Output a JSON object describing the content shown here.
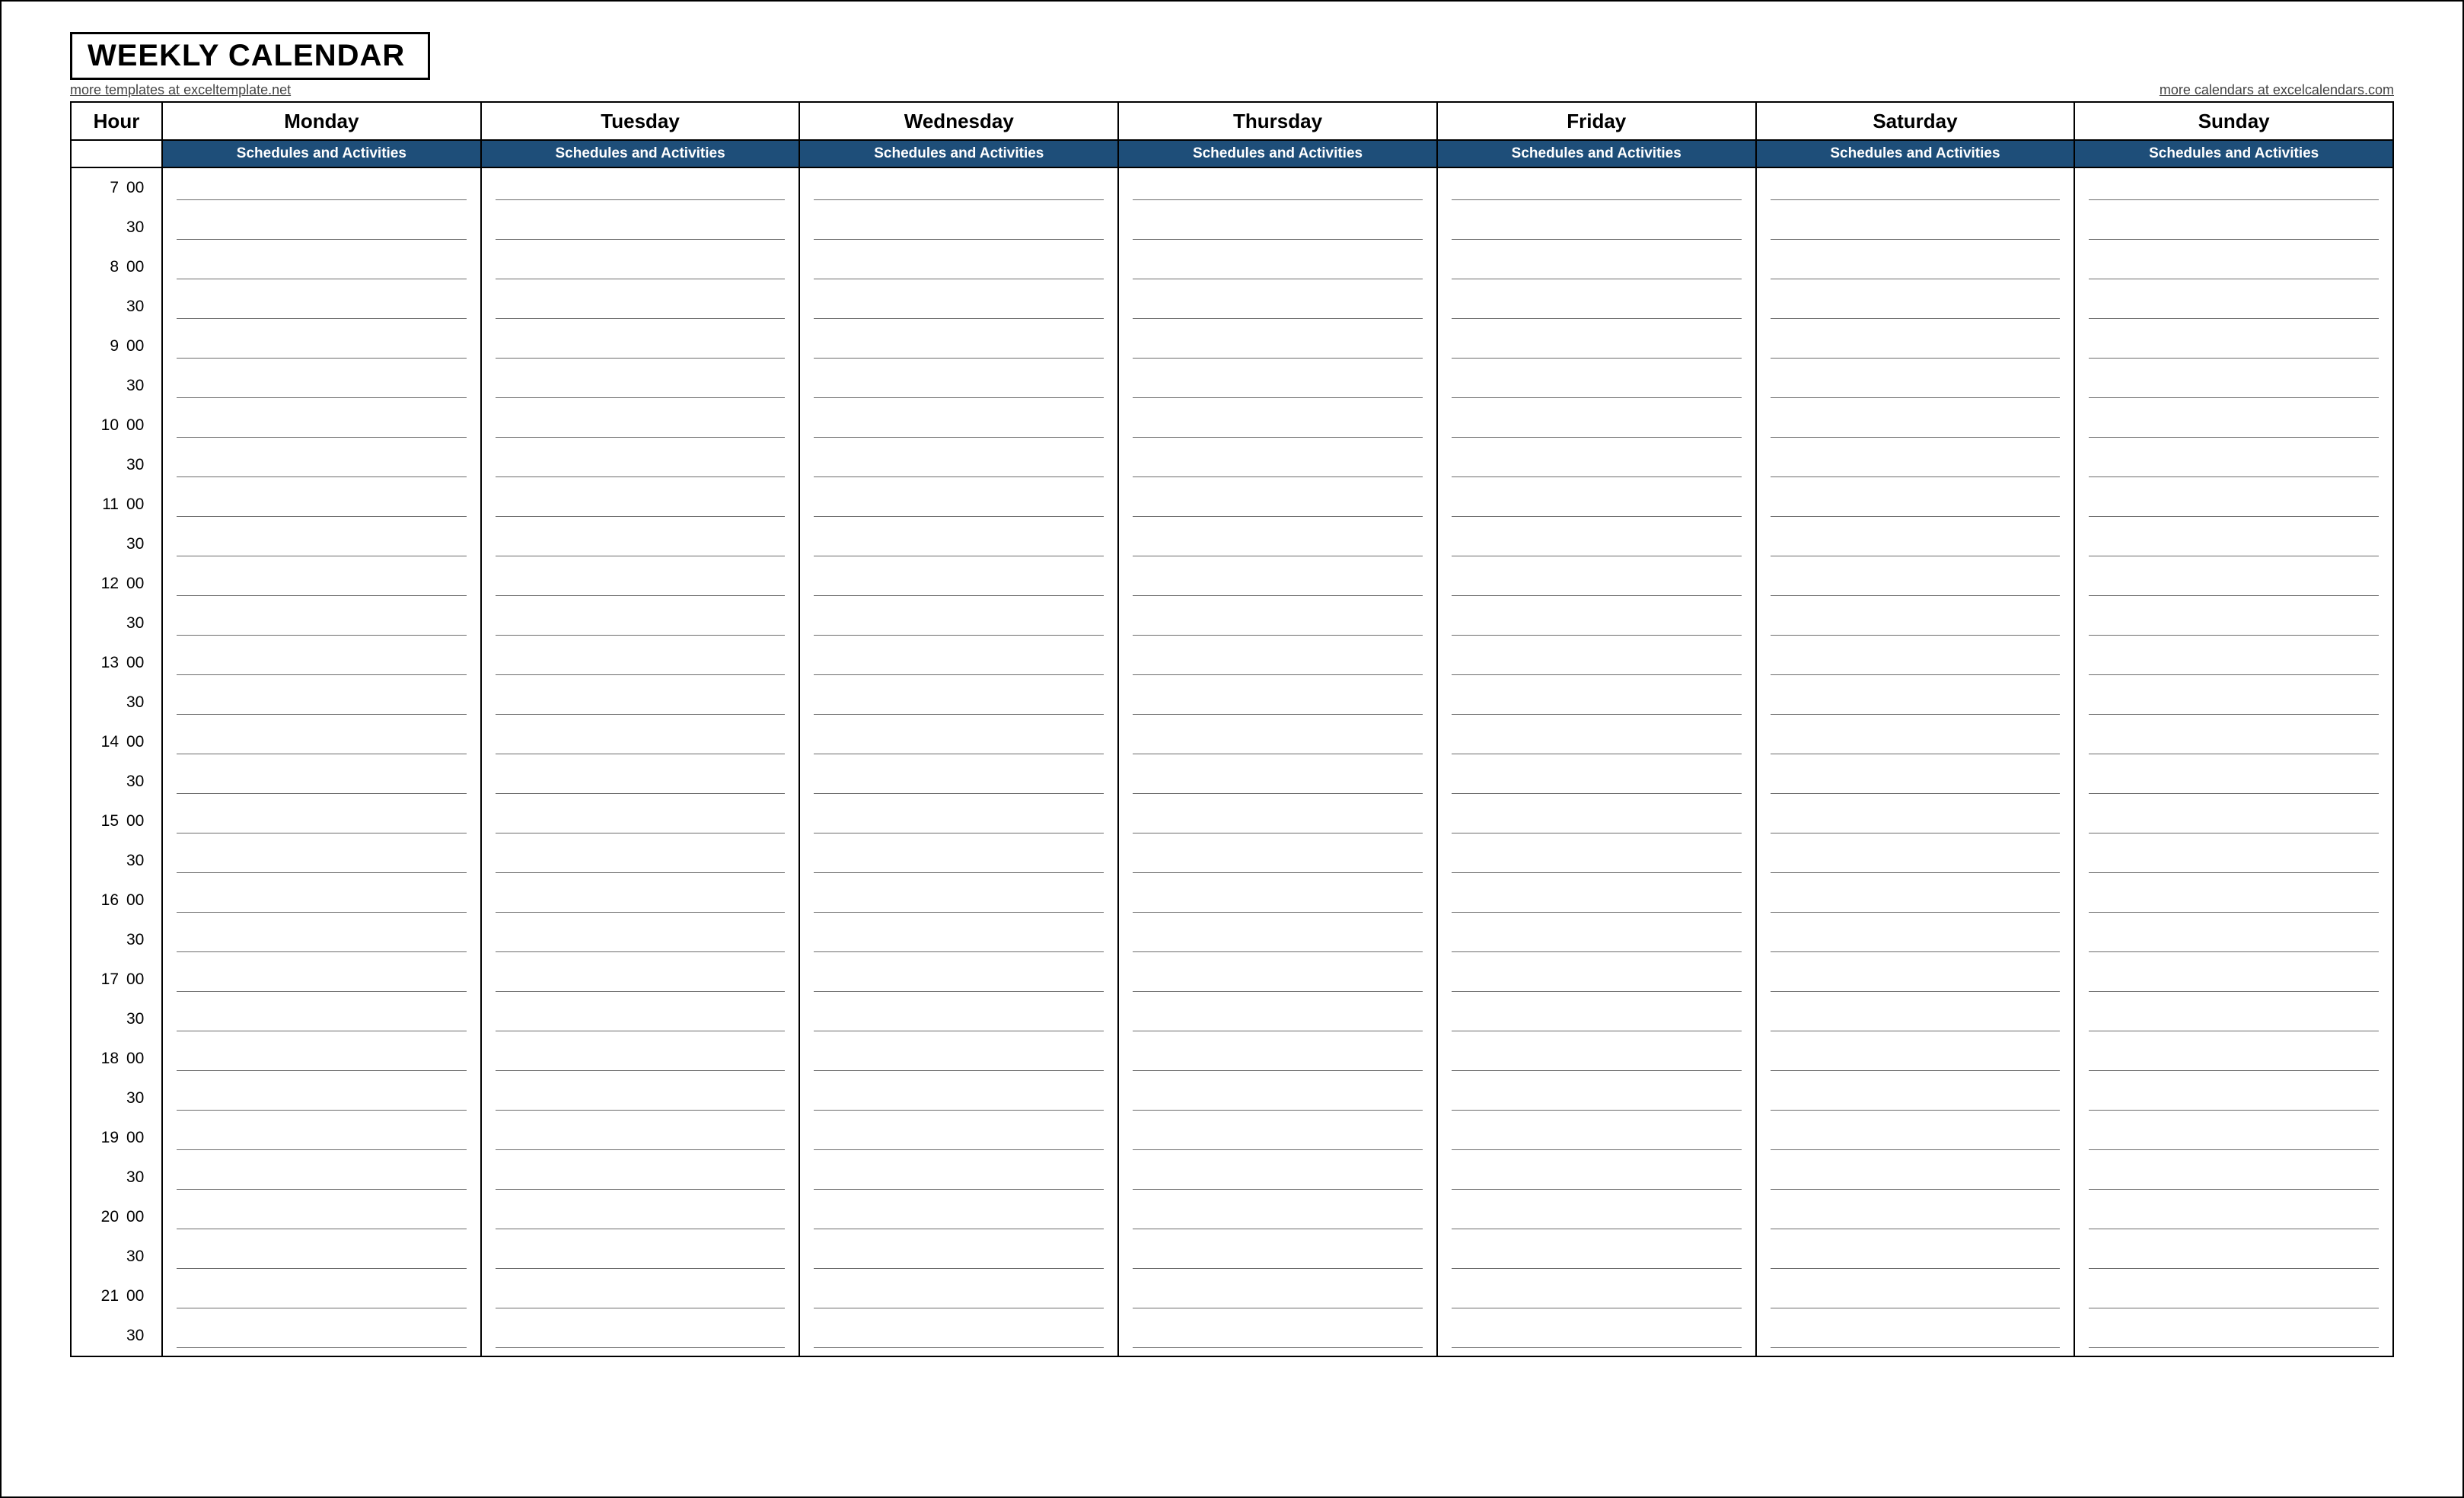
{
  "title": "WEEKLY CALENDAR",
  "link_left": "more templates at exceltemplate.net",
  "link_right": "more calendars at excelcalendars.com",
  "hour_header": "Hour",
  "subhead": "Schedules and Activities",
  "days": [
    "Monday",
    "Tuesday",
    "Wednesday",
    "Thursday",
    "Friday",
    "Saturday",
    "Sunday"
  ],
  "hours": [
    7,
    8,
    9,
    10,
    11,
    12,
    13,
    14,
    15,
    16,
    17,
    18,
    19,
    20,
    21
  ],
  "minutes": [
    "00",
    "30"
  ],
  "colors": {
    "band": "#1e4e79"
  }
}
